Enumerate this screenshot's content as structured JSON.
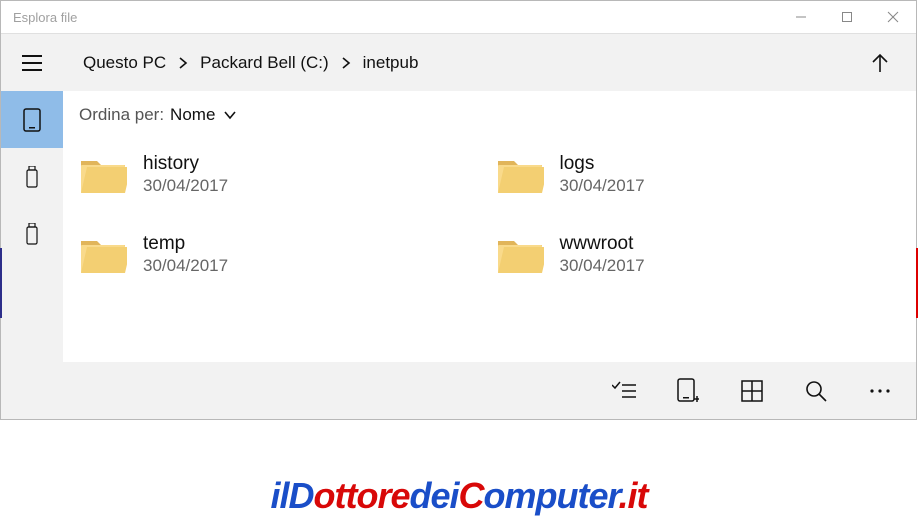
{
  "window": {
    "title": "Esplora file"
  },
  "breadcrumb": {
    "items": [
      "Questo PC",
      "Packard Bell (C:)",
      "inetpub"
    ]
  },
  "sort": {
    "label": "Ordina per:",
    "value": "Nome"
  },
  "files": [
    {
      "name": "history",
      "date": "30/04/2017"
    },
    {
      "name": "logs",
      "date": "30/04/2017"
    },
    {
      "name": "temp",
      "date": "30/04/2017"
    },
    {
      "name": "wwwroot",
      "date": "30/04/2017"
    }
  ],
  "watermark": {
    "parts": [
      {
        "text": "ilD",
        "c": "blue"
      },
      {
        "text": "ottore",
        "c": "red"
      },
      {
        "text": "dei",
        "c": "blue"
      },
      {
        "text": "C",
        "c": "red"
      },
      {
        "text": "omputer",
        "c": "blue"
      },
      {
        "text": ".it",
        "c": "red"
      }
    ]
  }
}
